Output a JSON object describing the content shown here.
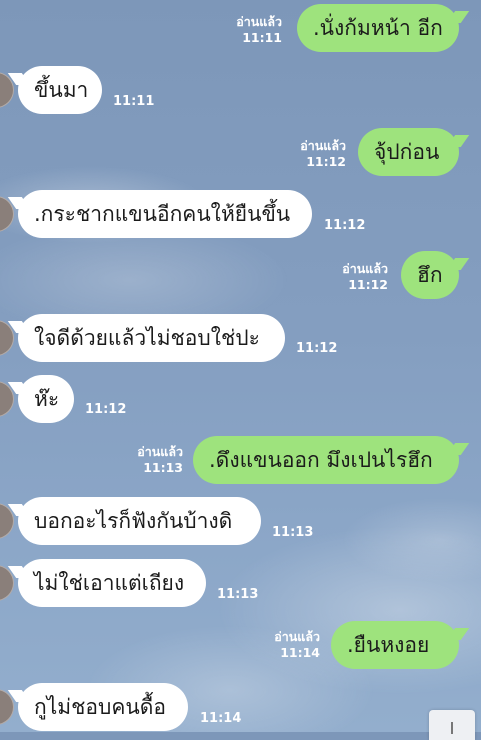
{
  "messages": [
    {
      "side": "out",
      "text": ".นั่งก้มหน้า อีก",
      "read": "อ่านแล้ว",
      "time": "11:11"
    },
    {
      "side": "in",
      "text": "ขึ้นมา",
      "time": "11:11"
    },
    {
      "side": "out",
      "text": "จุ้ปก่อน",
      "read": "อ่านแล้ว",
      "time": "11:12"
    },
    {
      "side": "in",
      "text": ".กระชากแขนอีกคนให้ยืนขึ้น",
      "time": "11:12"
    },
    {
      "side": "out",
      "text": "ฮึก",
      "read": "อ่านแล้ว",
      "time": "11:12"
    },
    {
      "side": "in",
      "text": "ใจดีด้วยแล้วไม่ชอบใช่ปะ",
      "time": "11:12"
    },
    {
      "side": "in",
      "text": "ห๊ะ",
      "time": "11:12"
    },
    {
      "side": "out",
      "text": ".ดึงแขนออก มึงเปนไรฮึก",
      "read": "อ่านแล้ว",
      "time": "11:13"
    },
    {
      "side": "in",
      "text": "บอกอะไรก็ฟังกันบ้างดิ",
      "time": "11:13"
    },
    {
      "side": "in",
      "text": "ไม่ใช่เอาแต่เถียง",
      "time": "11:13"
    },
    {
      "side": "out",
      "text": ".ยืนหงอย",
      "read": "อ่านแล้ว",
      "time": "11:14"
    },
    {
      "side": "in",
      "text": "กูไม่ชอบคนดื้อ",
      "time": "11:14"
    }
  ],
  "colors": {
    "outgoing_bubble": "#9ee37d",
    "incoming_bubble": "#ffffff",
    "background": "#849ec0"
  },
  "icons": {
    "corner": "scroll-down-icon"
  }
}
